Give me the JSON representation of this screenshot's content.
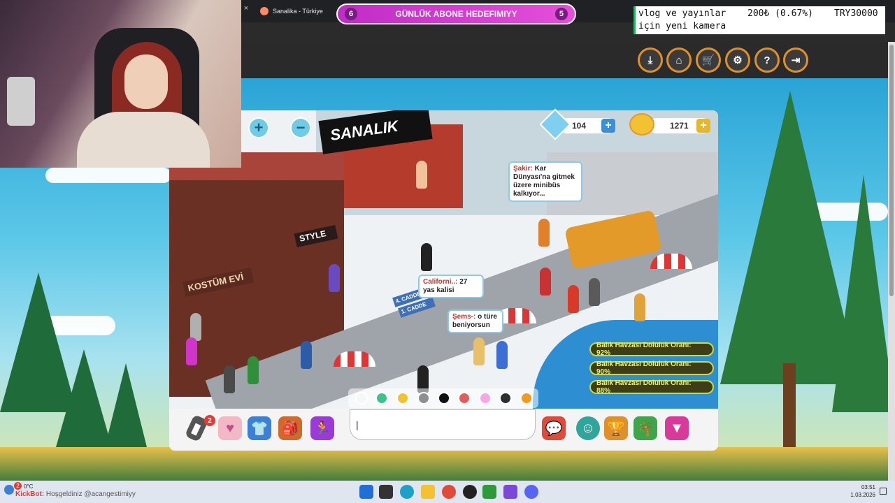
{
  "browser": {
    "tab_title": "Sanalika - Türkiye",
    "tab_close": "×"
  },
  "stream_goal": {
    "title": "GÜNLÜK ABONE HEDEFIMIYY",
    "current": "6",
    "target": "5"
  },
  "donation": {
    "title": "vlog ve yayınlar için yeni kamera",
    "amount": "200₺ (0.67%)",
    "target": "TRY30000"
  },
  "header_buttons": [
    {
      "name": "download-icon",
      "glyph": "⤓"
    },
    {
      "name": "home-icon",
      "glyph": "⌂"
    },
    {
      "name": "cart-icon",
      "glyph": "🛒"
    },
    {
      "name": "gear-icon",
      "glyph": "⚙"
    },
    {
      "name": "help-icon",
      "glyph": "?"
    },
    {
      "name": "logout-icon",
      "glyph": "⇥"
    }
  ],
  "scene": {
    "zoom_in": "+",
    "zoom_out": "−",
    "sign_text": "SANALIK",
    "shop_sign": "KOSTÜM EVİ",
    "style_sign": "STYLE",
    "street_sign_1": "1. CADDE",
    "street_sign_2": "4. CADDE",
    "diamonds": "104",
    "coins": "1271",
    "plus_label": "+"
  },
  "bubbles": [
    {
      "name": "Şakir:",
      "text": "Kar Dünyası'na gitmek üzere minibüs kalkıyor..."
    },
    {
      "name": "Californi..:",
      "text": "27 yas kalisi"
    },
    {
      "name": "Şems-:",
      "text": "o türe beniyorsun"
    }
  ],
  "notices": [
    "Balık Havzası Doluluk Oranı: 92%",
    "Balık Havzası Doluluk Oranı: 90%",
    "Balık Havzası Doluluk Oranı: 88%"
  ],
  "palette": [
    "#f7f7f7",
    "#3cc28a",
    "#f2c232",
    "#8f8f8f",
    "#111111",
    "#e35c5c",
    "#f7a6e8",
    "#2e2e2e",
    "#f29a1f"
  ],
  "toolbar": {
    "phone_badge": "2",
    "chat_value": "|"
  },
  "taskbar": {
    "weather": "0°C",
    "ticker_name": "KickBot:",
    "ticker_text": "Hoşgeldiniz @acangestimiyy",
    "notify_count": "2",
    "time": "03:51",
    "date": "1.03.2026"
  },
  "colors": {
    "accent_orange": "#e0902a",
    "goal_pink": "#d83ad2",
    "notice_green": "#c9dc3a"
  }
}
